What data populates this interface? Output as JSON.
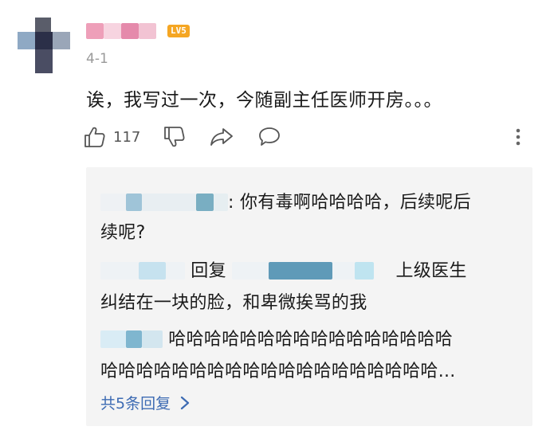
{
  "comment": {
    "level_badge": "LV5",
    "date": "4-1",
    "text": "诶，我写过一次，今随副主任医师开房。。。",
    "like_count": "117"
  },
  "icons": {
    "like": "thumbs-up-icon",
    "dislike": "thumbs-down-icon",
    "share": "share-icon",
    "reply": "comment-bubble-icon",
    "more": "more-vertical-icon"
  },
  "replies": {
    "reply1_text_line1": ": 你有毒啊哈哈哈哈，后续呢后",
    "reply1_text_line2": "续呢?",
    "reply2_reply_word": "回复",
    "reply2_text_line1": "上级医生",
    "reply2_text_line2": "纠结在一块的脸，和卑微挨骂的我",
    "reply3_text_line1": "哈哈哈哈哈哈哈哈哈哈哈哈哈哈哈哈",
    "reply3_text_line2": "哈哈哈哈哈哈哈哈哈哈哈哈哈哈哈哈哈哈哈...",
    "more_replies": "共5条回复"
  },
  "colors": {
    "link": "#3d6bb3",
    "badge": "#f5a623",
    "reply_bg": "#f4f4f4",
    "meta": "#9a9a9a"
  }
}
